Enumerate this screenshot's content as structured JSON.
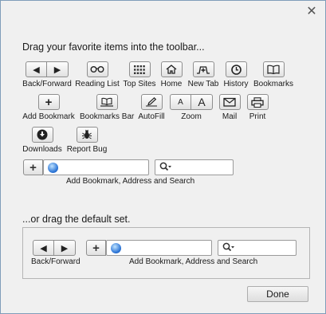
{
  "heading": "Drag your favorite items into the toolbar...",
  "default_heading": "...or drag the default set.",
  "items": {
    "back_forward": "Back/Forward",
    "reading_list": "Reading List",
    "top_sites": "Top Sites",
    "home": "Home",
    "new_tab": "New Tab",
    "history": "History",
    "bookmarks": "Bookmarks",
    "add_bookmark": "Add Bookmark",
    "bookmarks_bar": "Bookmarks Bar",
    "autofill": "AutoFill",
    "zoom": "Zoom",
    "zoom_small": "A",
    "zoom_large": "A",
    "mail": "Mail",
    "print": "Print",
    "downloads": "Downloads",
    "report_bug": "Report Bug",
    "address_search": "Add Bookmark, Address and Search"
  },
  "default_set": {
    "back_forward": "Back/Forward",
    "address_search": "Add Bookmark, Address and Search"
  },
  "done_label": "Done",
  "close_glyph": "✕"
}
